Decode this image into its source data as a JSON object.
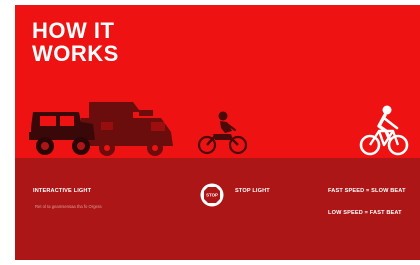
{
  "title": {
    "line1": "HOW IT",
    "line2": "WORKS"
  },
  "vehicles": [
    {
      "name": "jeep-icon"
    },
    {
      "name": "rv-camper-icon"
    },
    {
      "name": "motorcycle-rider-icon"
    },
    {
      "name": "bicycle-rider-icon"
    }
  ],
  "features": {
    "interactive_light": {
      "label": "INTERACTIVE LIGHT",
      "description": "Ret ol ta geamsensaa tha fo Orgera"
    },
    "stop_light": {
      "label": "STOP LIGHT",
      "sign_text": "STOP",
      "icon": "stop-sign-icon"
    },
    "speed_rules": [
      "FAST SPEED = SLOW BEAT",
      "LOW SPEED = FAST BEAT"
    ]
  },
  "colors": {
    "primary_red": "#ee1212",
    "dark_red": "#ad1616",
    "vehicle_dark": "#6b0d0d",
    "white": "#ffffff"
  }
}
